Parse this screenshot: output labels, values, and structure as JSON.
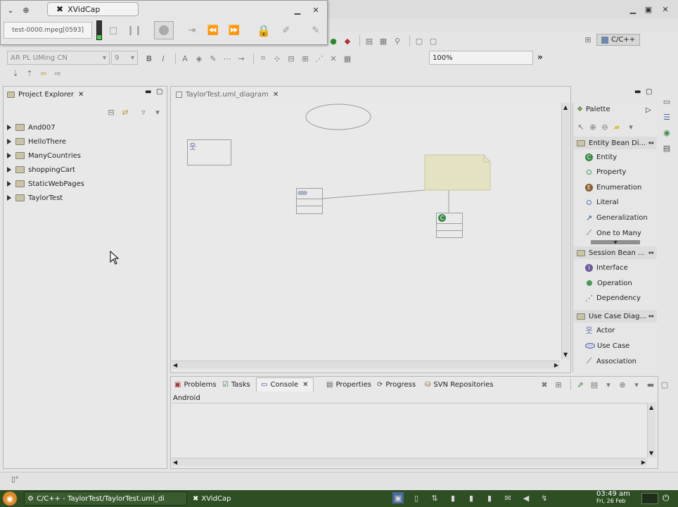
{
  "xvidcap": {
    "title": "XVidCap",
    "file": "test-0000.mpeg[0593]"
  },
  "toolbar": {
    "font_name": "AR PL UMing CN",
    "font_size": "9",
    "zoom": "100%",
    "perspective": "C/C++",
    "bold": "B",
    "italic": "I",
    "more": "»"
  },
  "project_explorer": {
    "title": "Project Explorer",
    "items": [
      "And007",
      "HelloThere",
      "ManyCountries",
      "shoppingCart",
      "StaticWebPages",
      "TaylorTest"
    ]
  },
  "editor": {
    "tab": "TaylorTest.uml_diagram"
  },
  "palette": {
    "title": "Palette",
    "groups": [
      {
        "name": "Entity Bean Di...",
        "items": [
          "Entity",
          "Property",
          "Enumeration",
          "Literal",
          "Generalization",
          "One to Many"
        ]
      },
      {
        "name": "Session Bean ...",
        "items": [
          "Interface",
          "Operation",
          "Dependency"
        ]
      },
      {
        "name": "Use Case Diag...",
        "items": [
          "Actor",
          "Use Case",
          "Association"
        ]
      }
    ]
  },
  "bottom": {
    "tabs": [
      "Problems",
      "Tasks",
      "Console",
      "Properties",
      "Progress",
      "SVN Repositories"
    ],
    "console_label": "Android"
  },
  "taskbar": {
    "app1": "C/C++ - TaylorTest/TaylorTest.uml_di",
    "app2": "XVidCap",
    "time": "03:49 am",
    "date": "Fri, 26 Feb"
  },
  "colors": {
    "note_fill": "#e4e2c2",
    "taskbar": "#2e4e24",
    "entity_icon": "#3a8a4a"
  }
}
